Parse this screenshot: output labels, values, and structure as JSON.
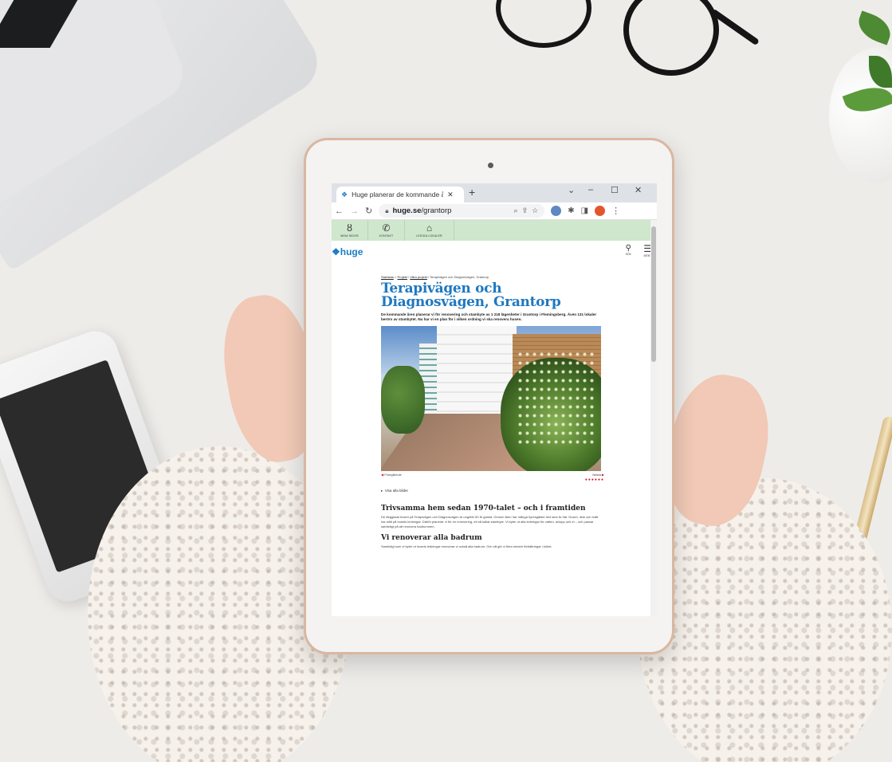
{
  "browser": {
    "tab_title": "Huge planerar de kommande år...",
    "tab_close": "✕",
    "new_tab": "+",
    "url_domain": "huge.se",
    "url_path": "/grantorp",
    "window_min": "–",
    "window_max": "☐",
    "window_close": "✕"
  },
  "topbar": {
    "items": [
      {
        "label": "MINA SIDOR",
        "icon": "person-icon"
      },
      {
        "label": "KONTAKT",
        "icon": "phone-icon"
      },
      {
        "label": "LEDIGA LOKALER",
        "icon": "house-icon"
      }
    ]
  },
  "site": {
    "logo": "huge",
    "search_label": "SÖK",
    "menu_label": "MENY"
  },
  "article": {
    "breadcrumb_start": "Startsida",
    "breadcrumb_1": "Projekt",
    "breadcrumb_2": "Våra projekt",
    "breadcrumb_current": "/ Terapivägen och Diagnosvägen, Grantorp",
    "title": "Terapivägen och Diagnosvägen, Grantorp",
    "lead": "De kommande åren planerar vi för renovering och stambyte av 1 218 lägenheter i Grantorp i Flemingsberg. Även 131 lokaler berörs av stambytet. Nu har vi en plan för i vilken ordning vi ska renovera husen.",
    "prev_label": "Föregående",
    "next_label": "Nästa",
    "show_all": "Visa alla bilder",
    "h2_1": "Trivsamma hem sedan 1970-talet – och i framtiden",
    "body_1": "De färggladа husen på Terapivägen och Diagnosvägen är ungefär 50 år gamla. Genom åren har många hyresgäster levt sina liv här. Dusch, disk och tvätt har slitit på husets ledningar. Därför planerar vi för en renovering, ett så kallat stambyte. Vi byter ut alla ledningar för vatten, avlopp och el – och passar samtidigt på att renovera badrummen.",
    "h2_2": "Vi renoverar alla badrum",
    "body_2": "Samtidigt som vi byter ut husets ledningar renoverar vi också alla badrum. Och så gör vi flera mindre förbättringar i köket."
  }
}
